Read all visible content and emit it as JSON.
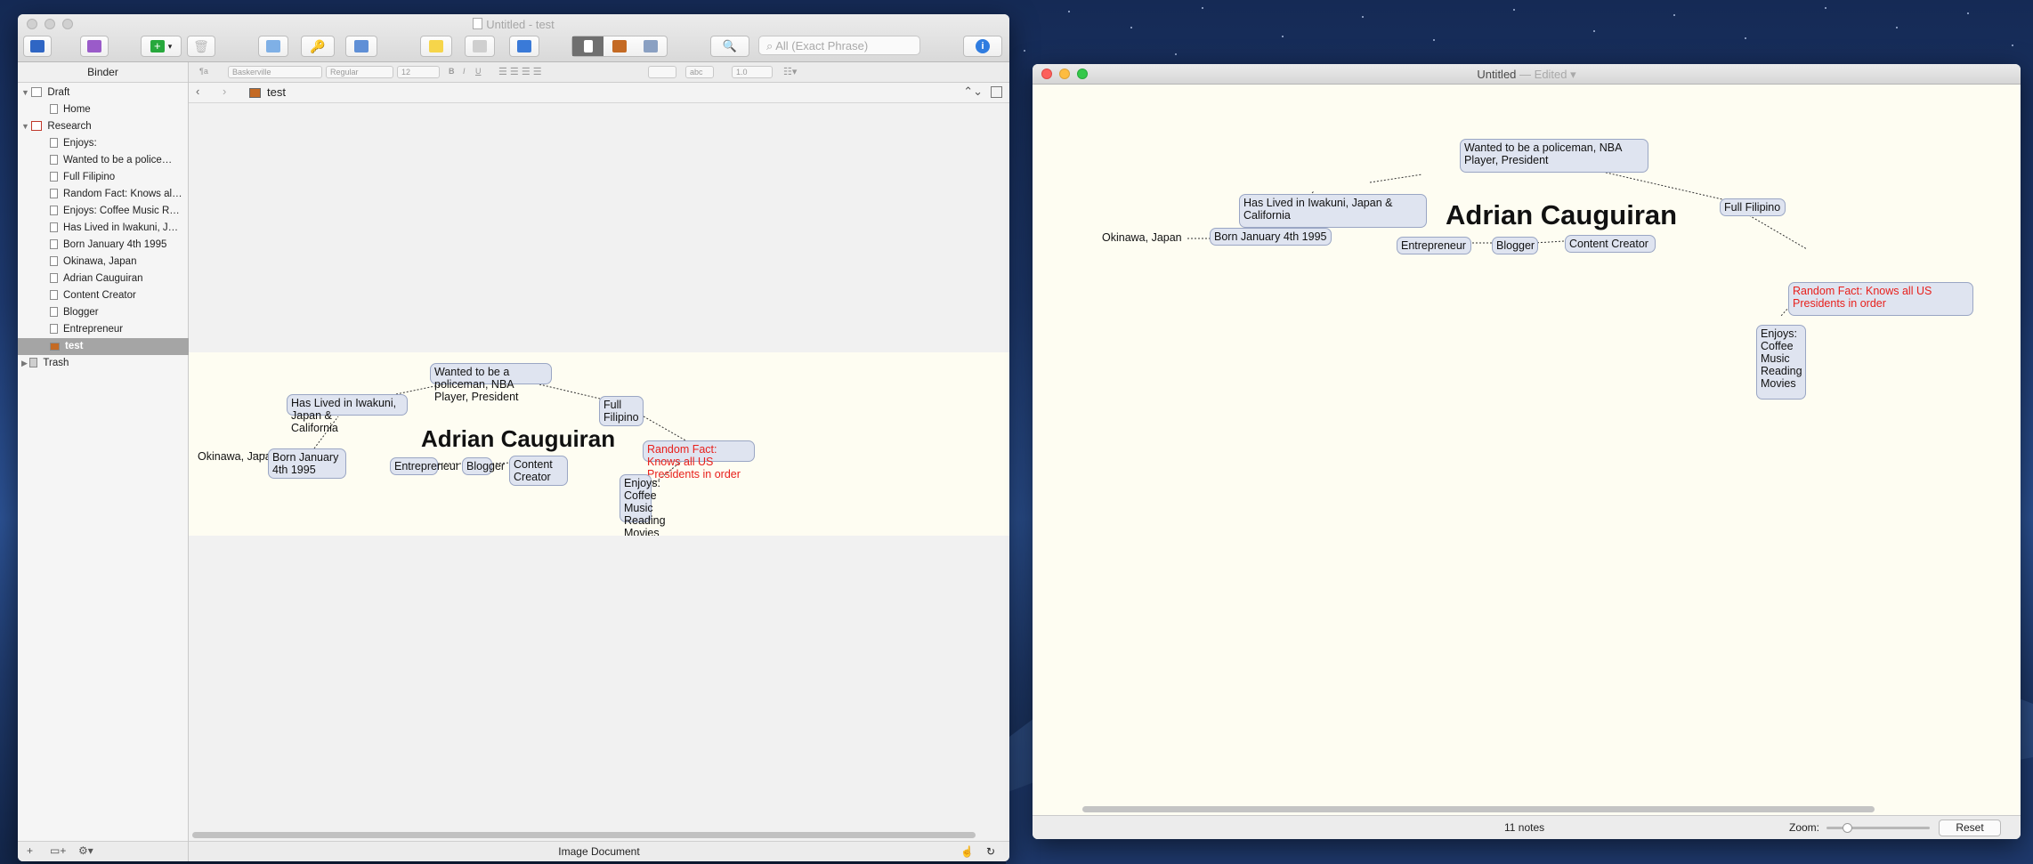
{
  "window1": {
    "title": "Untitled - test",
    "search_placeholder": "All (Exact Phrase)",
    "binder": {
      "header": "Binder",
      "items": [
        {
          "label": "Draft",
          "level": 0,
          "kind": "folder"
        },
        {
          "label": "Home",
          "level": 1,
          "kind": "doc"
        },
        {
          "label": "Research",
          "level": 0,
          "kind": "folder"
        },
        {
          "label": "Enjoys:",
          "level": 1,
          "kind": "doc"
        },
        {
          "label": "Wanted to be a police…",
          "level": 1,
          "kind": "doc"
        },
        {
          "label": "Full Filipino",
          "level": 1,
          "kind": "doc"
        },
        {
          "label": "Random Fact: Knows al…",
          "level": 1,
          "kind": "doc"
        },
        {
          "label": "Enjoys: Coffee Music R…",
          "level": 1,
          "kind": "doc"
        },
        {
          "label": "Has Lived in Iwakuni, J…",
          "level": 1,
          "kind": "doc"
        },
        {
          "label": "Born January 4th 1995",
          "level": 1,
          "kind": "doc"
        },
        {
          "label": "Okinawa, Japan",
          "level": 1,
          "kind": "doc"
        },
        {
          "label": "Adrian Cauguiran",
          "level": 1,
          "kind": "doc"
        },
        {
          "label": "Content Creator",
          "level": 1,
          "kind": "doc"
        },
        {
          "label": "Blogger",
          "level": 1,
          "kind": "doc"
        },
        {
          "label": "Entrepreneur",
          "level": 1,
          "kind": "doc"
        },
        {
          "label": "test",
          "level": 1,
          "kind": "image",
          "selected": true
        },
        {
          "label": "Trash",
          "level": 0,
          "kind": "trash"
        }
      ]
    },
    "format_bar": {
      "style": "¶a",
      "font": "Baskerville",
      "weight": "Regular",
      "size": "12",
      "bold": "B",
      "italic": "I",
      "underline": "U",
      "highlight": "abc",
      "line_spacing": "1.0"
    },
    "header_title": "test",
    "status": "Image Document"
  },
  "window2": {
    "title": "Untitled",
    "title_suffix": "— Edited",
    "notes_count": "11 notes",
    "zoom_label": "Zoom:",
    "zoom_level": 0.2,
    "reset_label": "Reset"
  },
  "mindmap": {
    "title": "Adrian Cauguiran",
    "plain_note": "Okinawa, Japan",
    "notes": [
      {
        "id": "born",
        "text": "Born January 4th 1995"
      },
      {
        "id": "lived",
        "text": "Has Lived in Iwakuni, Japan &\nCalifornia"
      },
      {
        "id": "wanted",
        "text": "Wanted to be a policeman, NBA\nPlayer, President"
      },
      {
        "id": "filipino",
        "text": "Full Filipino"
      },
      {
        "id": "random",
        "text": "Random Fact: Knows all US\nPresidents in order",
        "color": "#e8201c"
      },
      {
        "id": "enjoys",
        "text": "Enjoys:\nCoffee\nMusic\nReading\nMovies"
      },
      {
        "id": "entrepreneur",
        "text": "Entrepreneur"
      },
      {
        "id": "blogger",
        "text": "Blogger"
      },
      {
        "id": "creator",
        "text": "Content Creator"
      }
    ]
  }
}
